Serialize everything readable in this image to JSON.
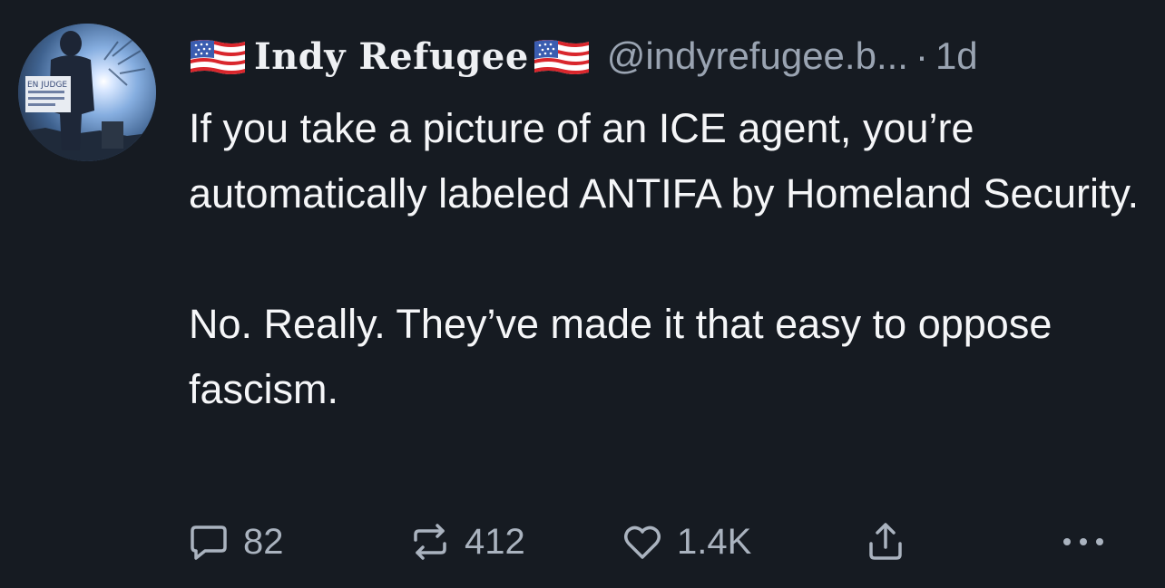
{
  "post": {
    "author": {
      "display_name": "Indy Refugee",
      "handle": "@indyrefugee.b...",
      "separator": "·",
      "time": "1d",
      "flag_icon": "us-flag-icon",
      "avatar_sign_text": "EN JUDGE"
    },
    "body": {
      "paragraph_1": "If you take a picture of an ICE agent, you’re automatically labeled ANTIFA by Homeland Security.",
      "paragraph_2": "No. Really. They’ve made it that easy to oppose fascism."
    },
    "actions": {
      "reply_icon": "reply-icon",
      "reply_count": "82",
      "repost_icon": "repost-icon",
      "repost_count": "412",
      "like_icon": "heart-icon",
      "like_count": "1.4K",
      "share_icon": "share-icon",
      "more_icon": "more-icon"
    }
  },
  "colors": {
    "background": "#161b22",
    "text_primary": "#f5f6f8",
    "text_secondary": "#9aa4b2"
  }
}
